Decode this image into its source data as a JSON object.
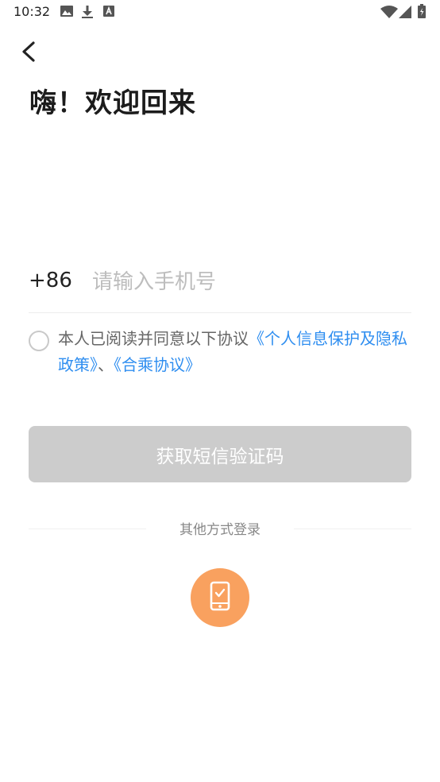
{
  "status_bar": {
    "time": "10:32",
    "icons": [
      "gallery-icon",
      "download-icon",
      "font-icon",
      "wifi-icon",
      "signal-icon",
      "battery-icon"
    ]
  },
  "header": {
    "back_icon": "chevron-left-icon",
    "title": "嗨！欢迎回来"
  },
  "phone": {
    "country_code": "+86",
    "placeholder": "请输入手机号",
    "value": ""
  },
  "agreement": {
    "checked": false,
    "prefix": "本人已阅读并同意以下协议",
    "link1": "《个人信息保护及隐私政策》",
    "separator": "、",
    "link2": "《合乘协议》"
  },
  "sms_button": {
    "label": "获取短信验证码"
  },
  "other_login": {
    "label": "其他方式登录",
    "phone_login_icon": "phone-check-icon"
  },
  "colors": {
    "link": "#2f8ef0",
    "button_disabled": "#cccccc",
    "accent_orange": "#f9a15f"
  }
}
